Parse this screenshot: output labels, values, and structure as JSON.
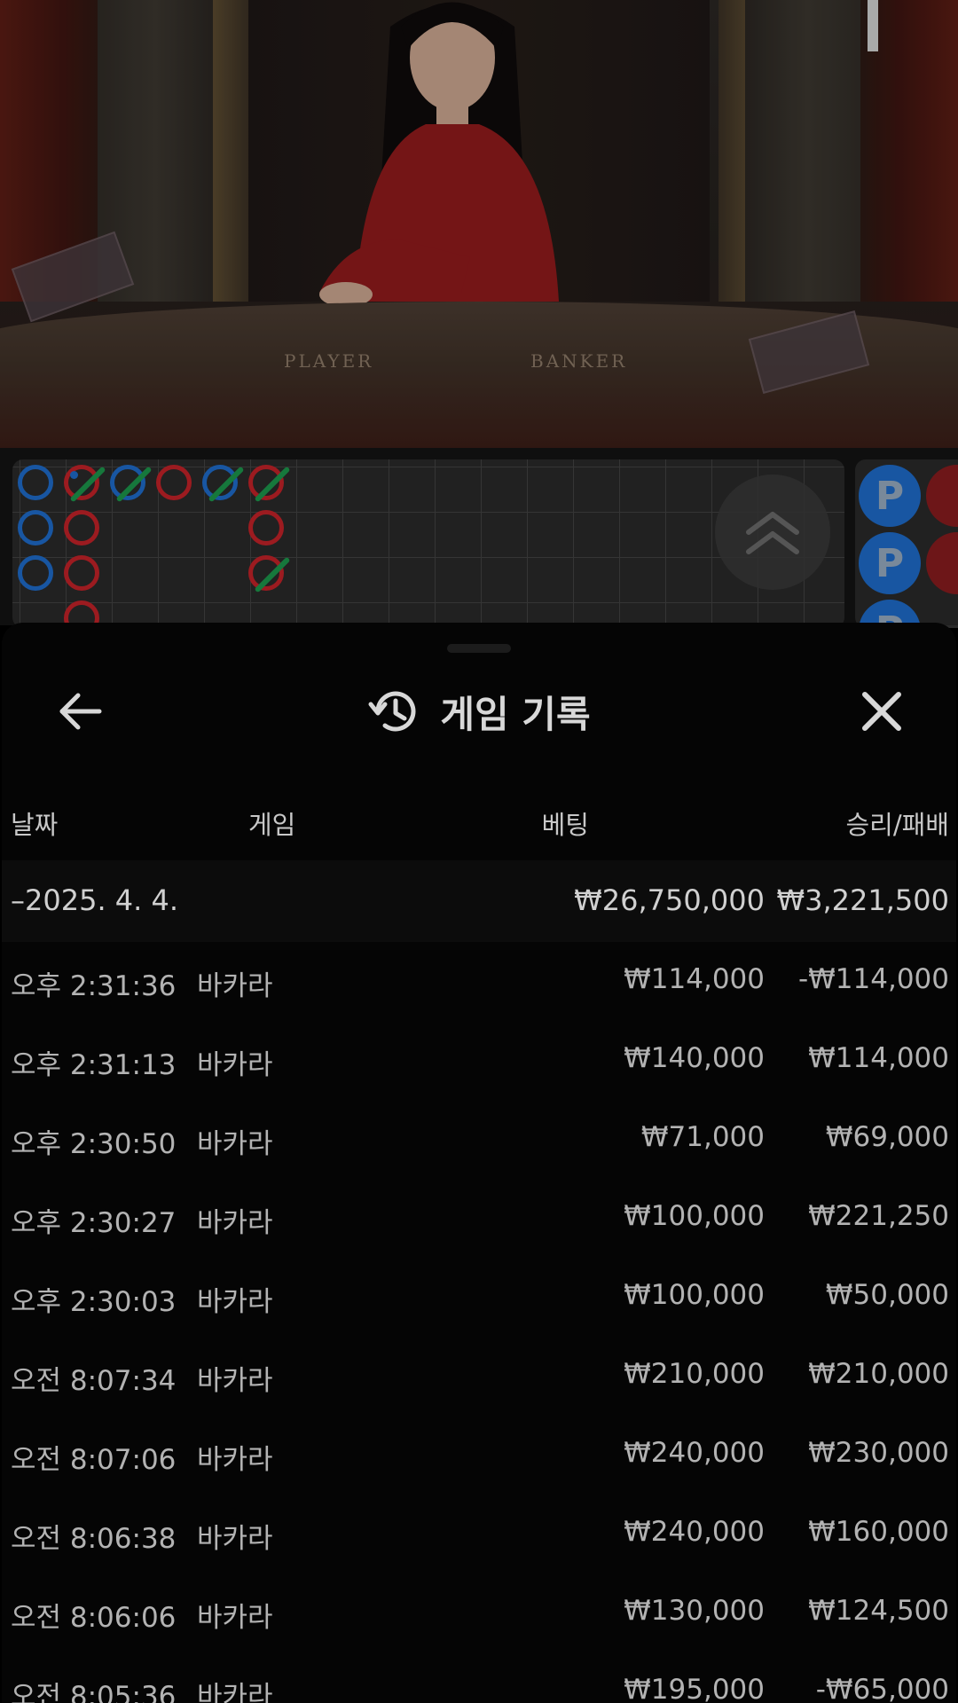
{
  "video": {
    "table_labels": [
      "PLAYER",
      "BANKER"
    ]
  },
  "roadmap": {
    "side_badge_letter": "P"
  },
  "sheet": {
    "title": "게임 기록",
    "columns": {
      "date": "날짜",
      "game": "게임",
      "bet": "베팅",
      "result": "승리/패배"
    },
    "date_group": {
      "label": "–2025. 4. 4.",
      "bet_total": "₩26,750,000",
      "result_total": "₩3,221,500"
    },
    "rows": [
      {
        "time": "오후 2:31:36",
        "game": "바카라",
        "bet": "₩114,000",
        "result": "-₩114,000"
      },
      {
        "time": "오후 2:31:13",
        "game": "바카라",
        "bet": "₩140,000",
        "result": "₩114,000"
      },
      {
        "time": "오후 2:30:50",
        "game": "바카라",
        "bet": "₩71,000",
        "result": "₩69,000"
      },
      {
        "time": "오후 2:30:27",
        "game": "바카라",
        "bet": "₩100,000",
        "result": "₩221,250"
      },
      {
        "time": "오후 2:30:03",
        "game": "바카라",
        "bet": "₩100,000",
        "result": "₩50,000"
      },
      {
        "time": "오전 8:07:34",
        "game": "바카라",
        "bet": "₩210,000",
        "result": "₩210,000"
      },
      {
        "time": "오전 8:07:06",
        "game": "바카라",
        "bet": "₩240,000",
        "result": "₩230,000"
      },
      {
        "time": "오전 8:06:38",
        "game": "바카라",
        "bet": "₩240,000",
        "result": "₩160,000"
      },
      {
        "time": "오전 8:06:06",
        "game": "바카라",
        "bet": "₩130,000",
        "result": "₩124,500"
      },
      {
        "time": "오전 8:05:36",
        "game": "바카라",
        "bet": "₩195,000",
        "result": "-₩65,000"
      }
    ]
  }
}
